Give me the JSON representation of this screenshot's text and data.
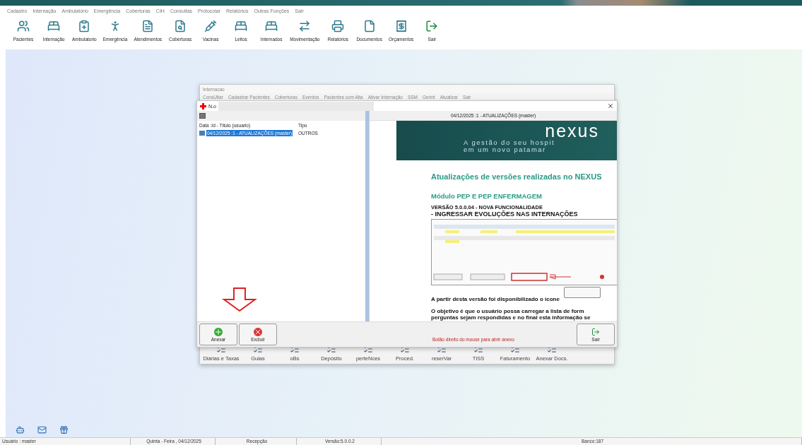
{
  "menu": [
    "Cadastro",
    "Internação",
    "Ambulatório",
    "Emergência",
    "Coberturas",
    "CIH",
    "Consultas",
    "Protocolar",
    "Relatórios",
    "Outras Funções",
    "Sair"
  ],
  "toolbar": [
    {
      "label": "Pacientes",
      "kind": "users"
    },
    {
      "label": "Internação",
      "kind": "bed"
    },
    {
      "label": "Ambulatorio",
      "kind": "clipboard"
    },
    {
      "label": "Emergência",
      "kind": "person"
    },
    {
      "label": "Atendimentos",
      "kind": "doc"
    },
    {
      "label": "Coberturas",
      "kind": "search"
    },
    {
      "label": "Vacinas",
      "kind": "syringe"
    },
    {
      "label": "Leitos",
      "kind": "bed"
    },
    {
      "label": "Internados",
      "kind": "bed"
    },
    {
      "label": "Movimentação",
      "kind": "move"
    },
    {
      "label": "Relatórios",
      "kind": "printer"
    },
    {
      "label": "Documentos",
      "kind": "file"
    },
    {
      "label": "Orçamentos",
      "kind": "money"
    },
    {
      "label": "Sair",
      "kind": "exit"
    }
  ],
  "background_window": {
    "title": "Internacao",
    "menu": [
      "ConsUltar",
      "Cadastrar Pacientes",
      "Coberturas",
      "Eventos",
      "Pacientes com Alta",
      "Ativar Internação",
      "SSM",
      "Gerint",
      "Atualizar",
      "Sair"
    ],
    "toolbar": [
      "Diárias e Taxas",
      "Guias",
      "oBs",
      "Depósito",
      "perteNces",
      "Proced.",
      "reserVar",
      "TISS",
      "Faturamento",
      "Anexar Docs."
    ]
  },
  "dialog": {
    "title": "N.o",
    "columns": [
      "Data :Id - Título (usuario)",
      "Tipo"
    ],
    "rows": [
      {
        "title": "04/12/2025 :1 - ATUALIZAÇÕES (master)",
        "type": "OUTROS",
        "selected": true
      }
    ],
    "viewer_title": "04/12/2025 :1 - ATUALIZAÇÕES (master)",
    "document": {
      "brand": "nexus",
      "tagline": [
        "A gestão do seu hospit",
        "em um novo patamar"
      ],
      "heading": "Atualizações de versões realizadas no NEXUS",
      "module": "Módulo PEP E PEP ENFERMAGEM",
      "version": "VERSÃO 5.0.0.04 - NOVA FUNCIONALIDADE",
      "feature": "- INGRESSAR EVOLUÇÕES NAS INTERNAÇÕES",
      "paragraphs": [
        "A partir desta versão foi disponibilizado o ícone",
        "O objetivo é que o usuário possa carregar a lista de form",
        "perguntas sejam respondidas e no final esta informação se"
      ]
    },
    "buttons": [
      {
        "label": "Anexar",
        "kind": "add"
      },
      {
        "label": "Excluir",
        "kind": "delete"
      }
    ],
    "hint": "Botão direito do mouse para abrir anexo",
    "exit_button": "Sair"
  },
  "status_bar": [
    "Usuário : master",
    "Quinta - Feira , 04/12/2025",
    "Recepção",
    "Versão:5.0.0.2",
    "Banco:187"
  ]
}
